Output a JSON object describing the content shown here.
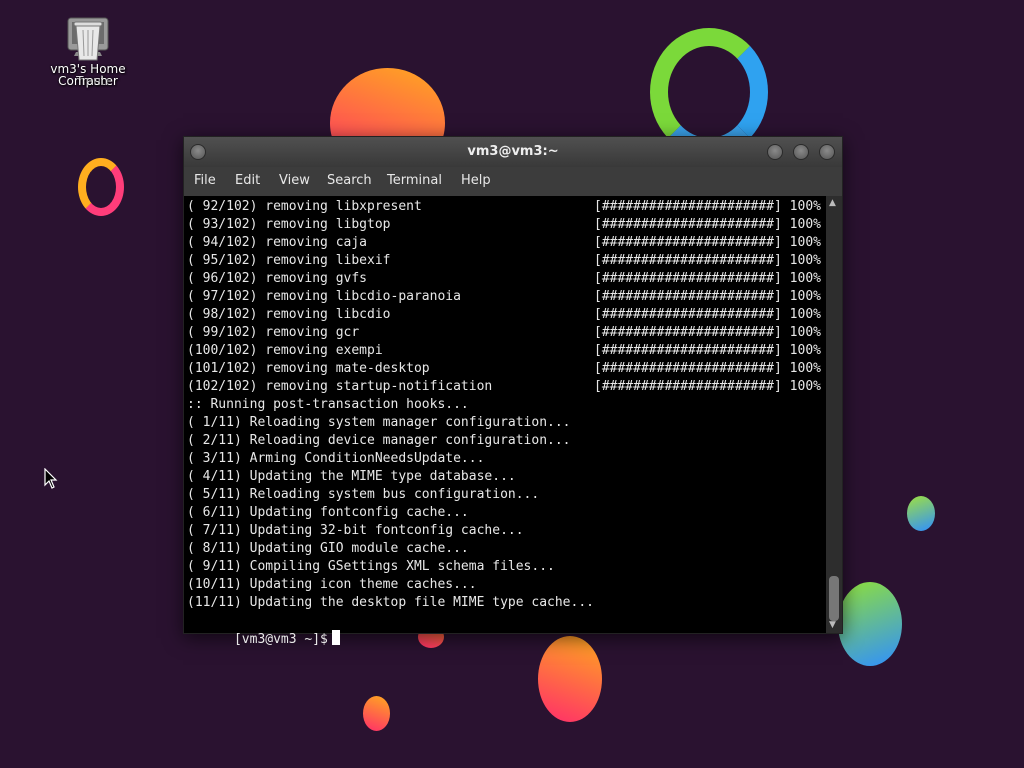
{
  "colors": {
    "background": "#2a1230",
    "terminal_bg": "#000000",
    "terminal_fg": "#e8e8e8"
  },
  "desktop": {
    "icons": [
      {
        "name": "computer-icon",
        "label": "vm3's Home"
      },
      {
        "name": "trash-icon",
        "label": "Computer"
      },
      {
        "name": "trash-icon",
        "label": "Trash"
      }
    ],
    "icon_labels": {
      "line1": "vm3's Home",
      "line2a": "Computer",
      "line2b": "Trash"
    }
  },
  "window": {
    "title": "vm3@vm3:~",
    "menu": [
      "File",
      "Edit",
      "View",
      "Search",
      "Terminal",
      "Help"
    ]
  },
  "terminal": {
    "progress_text": "[######################] 100%",
    "progress_lines": [
      "( 92/102) removing libxpresent",
      "( 93/102) removing libgtop",
      "( 94/102) removing caja",
      "( 95/102) removing libexif",
      "( 96/102) removing gvfs",
      "( 97/102) removing libcdio-paranoia",
      "( 98/102) removing libcdio",
      "( 99/102) removing gcr",
      "(100/102) removing exempi",
      "(101/102) removing mate-desktop",
      "(102/102) removing startup-notification"
    ],
    "hook_lines": [
      ":: Running post-transaction hooks...",
      "( 1/11) Reloading system manager configuration...",
      "( 2/11) Reloading device manager configuration...",
      "( 3/11) Arming ConditionNeedsUpdate...",
      "( 4/11) Updating the MIME type database...",
      "( 5/11) Reloading system bus configuration...",
      "( 6/11) Updating fontconfig cache...",
      "( 7/11) Updating 32-bit fontconfig cache...",
      "( 8/11) Updating GIO module cache...",
      "( 9/11) Compiling GSettings XML schema files...",
      "(10/11) Updating icon theme caches...",
      "(11/11) Updating the desktop file MIME type cache..."
    ],
    "prompt": "[vm3@vm3 ~]$"
  }
}
